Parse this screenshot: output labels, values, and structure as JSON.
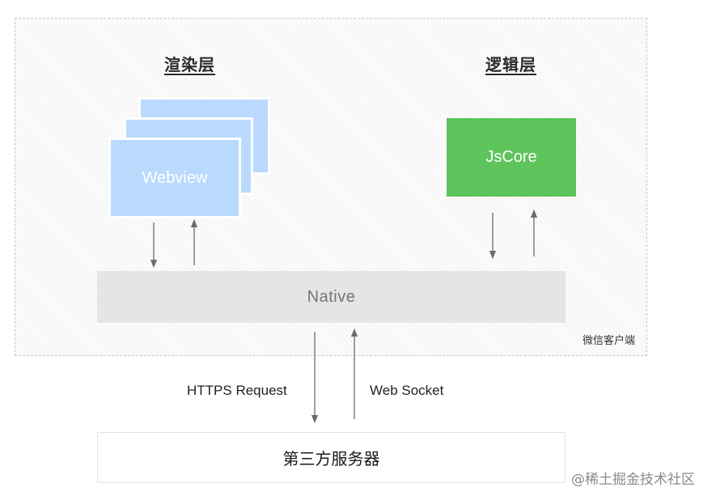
{
  "render_layer": {
    "title": "渲染层",
    "webview_label": "Webview"
  },
  "logic_layer": {
    "title": "逻辑层",
    "jscore_label": "JsCore"
  },
  "native": {
    "label": "Native"
  },
  "client": {
    "label": "微信客户端"
  },
  "connections": {
    "https_label": "HTTPS Request",
    "websocket_label": "Web Socket"
  },
  "server": {
    "label": "第三方服务器"
  },
  "watermark": {
    "text": "@稀土掘金技术社区"
  },
  "colors": {
    "webview": "#b9dafd",
    "jscore": "#5ec45c",
    "native": "#e5e5e5",
    "arrow": "#6b6b6b"
  }
}
